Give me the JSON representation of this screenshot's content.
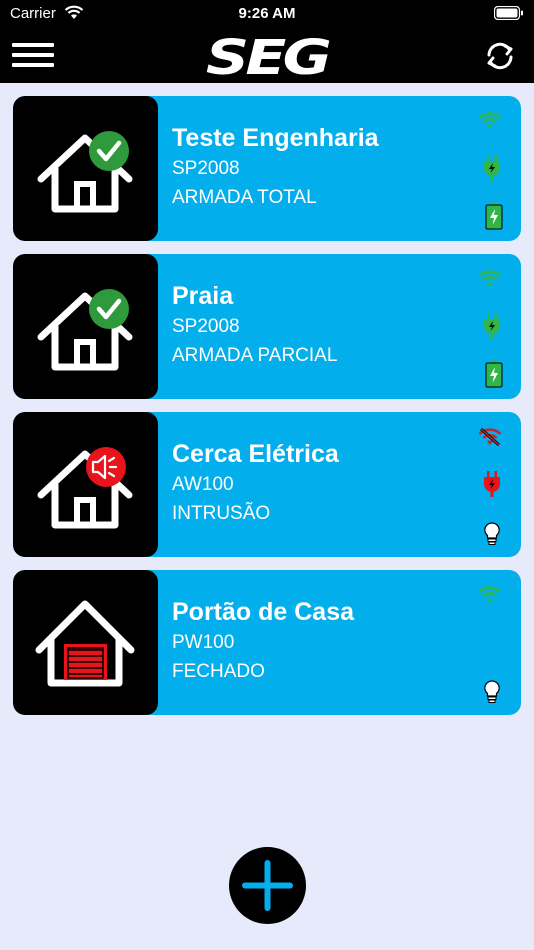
{
  "status_bar": {
    "carrier": "Carrier",
    "time": "9:26 AM"
  },
  "app": {
    "logo": "SEG"
  },
  "colors": {
    "card": "#03aeec",
    "background": "#e7eafb",
    "armed_badge": "#2e9a3c",
    "alarm_badge": "#e8131b",
    "signal_ok": "#2fb54a",
    "signal_lost": "#c0282e"
  },
  "devices": [
    {
      "name": "Teste Engenharia",
      "model": "SP2008",
      "status": "ARMADA TOTAL",
      "icon": "house-check-icon",
      "wifi": "wifi-ok-icon",
      "power": "plug-ok-icon",
      "extra": "battery-charging-icon"
    },
    {
      "name": "Praia",
      "model": "SP2008",
      "status": "ARMADA PARCIAL",
      "icon": "house-check-icon",
      "wifi": "wifi-ok-icon",
      "power": "plug-ok-icon",
      "extra": "battery-charging-icon"
    },
    {
      "name": "Cerca Elétrica",
      "model": "AW100",
      "status": "INTRUSÃO",
      "icon": "house-siren-icon",
      "wifi": "wifi-off-icon",
      "power": "plug-fault-icon",
      "extra": "lightbulb-icon"
    },
    {
      "name": "Portão de Casa",
      "model": "PW100",
      "status": "FECHADO",
      "icon": "house-garage-icon",
      "wifi": "wifi-ok-icon",
      "power": "",
      "extra": "lightbulb-icon"
    }
  ]
}
